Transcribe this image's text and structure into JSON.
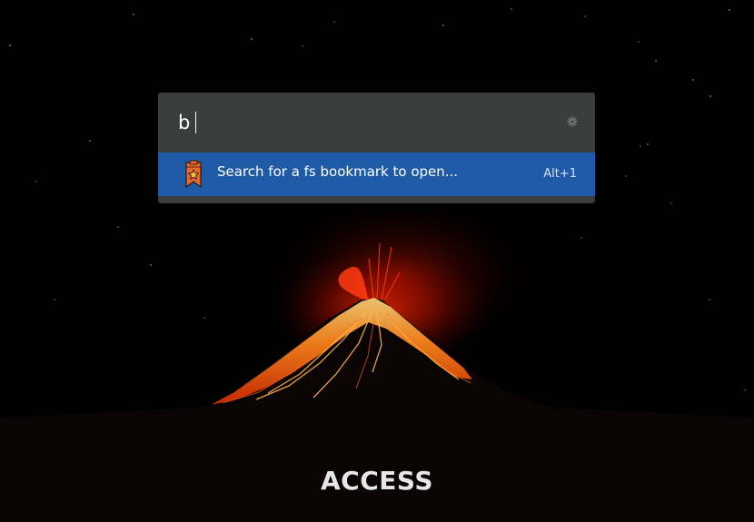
{
  "launcher": {
    "query": "b",
    "prefs_icon": "gear-icon",
    "results": [
      {
        "icon": "bookmark-star-icon",
        "title": "Search for a fs bookmark to open...",
        "shortcut": "Alt+1"
      }
    ]
  },
  "caption": "ACCESS",
  "colors": {
    "launcher_bg": "#393d3b",
    "selected_bg": "#1f5aa6",
    "bookmark_icon": "#e9692c",
    "lava": "#ff3b10"
  }
}
